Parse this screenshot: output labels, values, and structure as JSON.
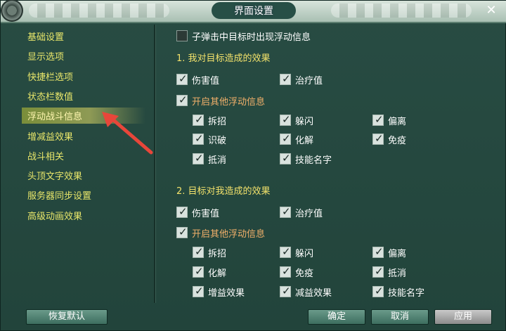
{
  "window": {
    "title": "界面设置"
  },
  "sidebar": {
    "items": [
      {
        "label": "基础设置"
      },
      {
        "label": "显示选项"
      },
      {
        "label": "快捷栏选项"
      },
      {
        "label": "状态栏数值"
      },
      {
        "label": "浮动战斗信息",
        "active": true
      },
      {
        "label": "增减益效果"
      },
      {
        "label": "战斗相关"
      },
      {
        "label": "头顶文字效果"
      },
      {
        "label": "服务器同步设置"
      },
      {
        "label": "高级动画效果"
      }
    ]
  },
  "top_option": {
    "label": "子弹击中目标时出现浮动信息",
    "checked": false
  },
  "section1": {
    "title": "1. 我对目标造成的效果",
    "damage": {
      "label": "伤害值",
      "checked": true
    },
    "heal": {
      "label": "治疗值",
      "checked": true
    },
    "other": {
      "label": "开启其他浮动信息",
      "checked": true
    },
    "items": [
      {
        "label": "拆招",
        "checked": true
      },
      {
        "label": "躲闪",
        "checked": true
      },
      {
        "label": "偏离",
        "checked": true
      },
      {
        "label": "识破",
        "checked": true
      },
      {
        "label": "化解",
        "checked": true
      },
      {
        "label": "免疫",
        "checked": true
      },
      {
        "label": "抵消",
        "checked": true
      },
      {
        "label": "技能名字",
        "checked": true
      }
    ]
  },
  "section2": {
    "title": "2. 目标对我造成的效果",
    "damage": {
      "label": "伤害值",
      "checked": true
    },
    "heal": {
      "label": "治疗值",
      "checked": true
    },
    "other": {
      "label": "开启其他浮动信息",
      "checked": true
    },
    "items": [
      {
        "label": "拆招",
        "checked": true
      },
      {
        "label": "躲闪",
        "checked": true
      },
      {
        "label": "偏离",
        "checked": true
      },
      {
        "label": "化解",
        "checked": true
      },
      {
        "label": "免疫",
        "checked": true
      },
      {
        "label": "抵消",
        "checked": true
      },
      {
        "label": "增益效果",
        "checked": true
      },
      {
        "label": "减益效果",
        "checked": true
      },
      {
        "label": "技能名字",
        "checked": true
      }
    ]
  },
  "buttons": {
    "reset": "恢复默认",
    "ok": "确定",
    "cancel": "取消",
    "apply": "应用"
  },
  "colors": {
    "accent_text": "#e8e66a",
    "orange_text": "#f2b06a",
    "arrow": "#e8463a"
  }
}
